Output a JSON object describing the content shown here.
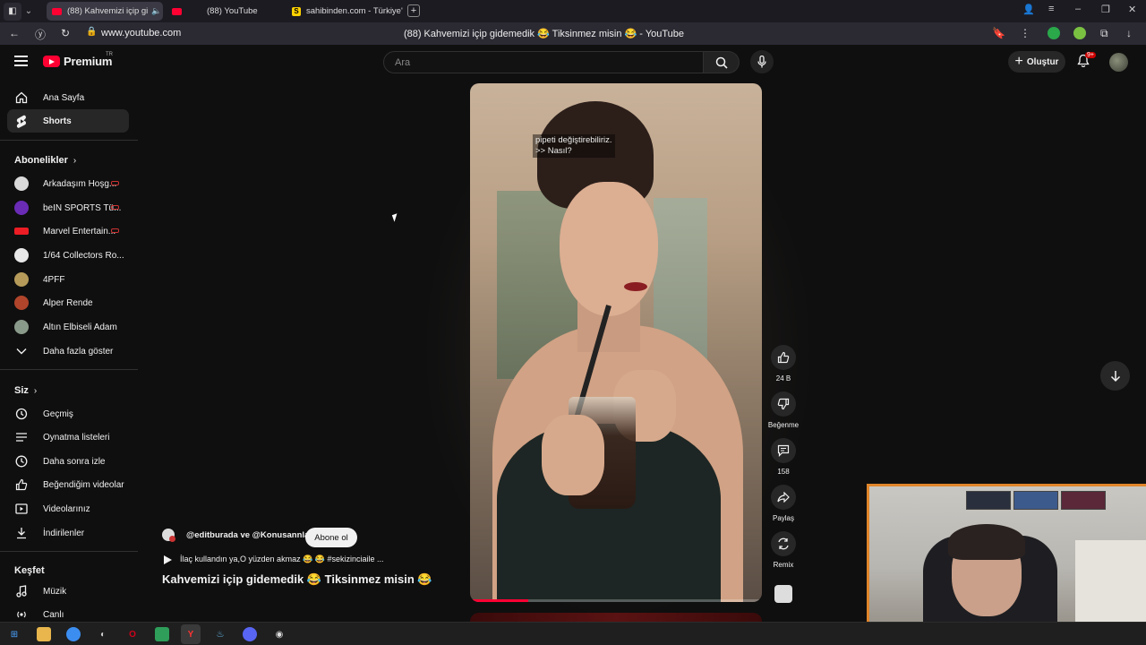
{
  "browser": {
    "tabs": [
      {
        "title": "(88) Kahvemizi içip gi",
        "active": true
      },
      {
        "title": "(88) YouTube",
        "active": false
      },
      {
        "title": "sahibinden.com - Türkiye'",
        "active": false
      }
    ],
    "url": "www.youtube.com",
    "page_title": "(88) Kahvemizi içip gidemedik 😂 Tiksinmez misin 😂 - YouTube"
  },
  "header": {
    "brand": "Premium",
    "brand_sup": "TR",
    "search_placeholder": "Ara",
    "create_label": "Oluştur",
    "notif_badge": "9+"
  },
  "sidebar": {
    "main": [
      {
        "label": "Ana Sayfa",
        "icon": "home-icon"
      },
      {
        "label": "Shorts",
        "icon": "shorts-icon",
        "active": true
      }
    ],
    "subs_heading": "Abonelikler",
    "subscriptions": [
      {
        "label": "Arkadaşım Hoşg...",
        "live": true,
        "color": "#d9d9d9"
      },
      {
        "label": "beIN SPORTS Tü...",
        "live": true,
        "color": "#6a2bb5"
      },
      {
        "label": "Marvel Entertain...",
        "live": true,
        "color": "#ec1d24"
      },
      {
        "label": "1/64 Collectors Ro...",
        "live": false,
        "color": "#e8e8e8"
      },
      {
        "label": "4PFF",
        "live": false,
        "color": "#b59a5a"
      },
      {
        "label": "Alper Rende",
        "live": false,
        "color": "#b0452b"
      },
      {
        "label": "Altın Elbiseli Adam",
        "live": false,
        "color": "#8a9a8a"
      }
    ],
    "show_more": "Daha fazla göster",
    "you_heading": "Siz",
    "you": [
      {
        "label": "Geçmiş",
        "icon": "history-icon"
      },
      {
        "label": "Oynatma listeleri",
        "icon": "playlists-icon"
      },
      {
        "label": "Daha sonra izle",
        "icon": "watch-later-icon"
      },
      {
        "label": "Beğendiğim videolar",
        "icon": "liked-icon"
      },
      {
        "label": "Videolarınız",
        "icon": "your-videos-icon"
      },
      {
        "label": "İndirilenler",
        "icon": "downloads-icon"
      }
    ],
    "explore_heading": "Keşfet",
    "explore": [
      {
        "label": "Müzik",
        "icon": "music-icon"
      },
      {
        "label": "Canlı",
        "icon": "live-icon"
      }
    ]
  },
  "short": {
    "caption_line1": "pipeti değiştirebiliriz.",
    "caption_line2": ">> Nasıl?",
    "progress": 0.2,
    "channel": "@editburada ve @Konusannlar",
    "subscribe_label": "Abone ol",
    "music_text": "İlaç kullandın ya,O yüzden akmaz 😂 😂 #sekizinciaile ...",
    "title": "Kahvemizi içip gidemedik 😂 Tiksinmez misin 😂",
    "actions": {
      "likes": "24 B",
      "dislike_label": "Beğenme",
      "comments": "158",
      "share_label": "Paylaş",
      "remix_label": "Remix"
    }
  }
}
